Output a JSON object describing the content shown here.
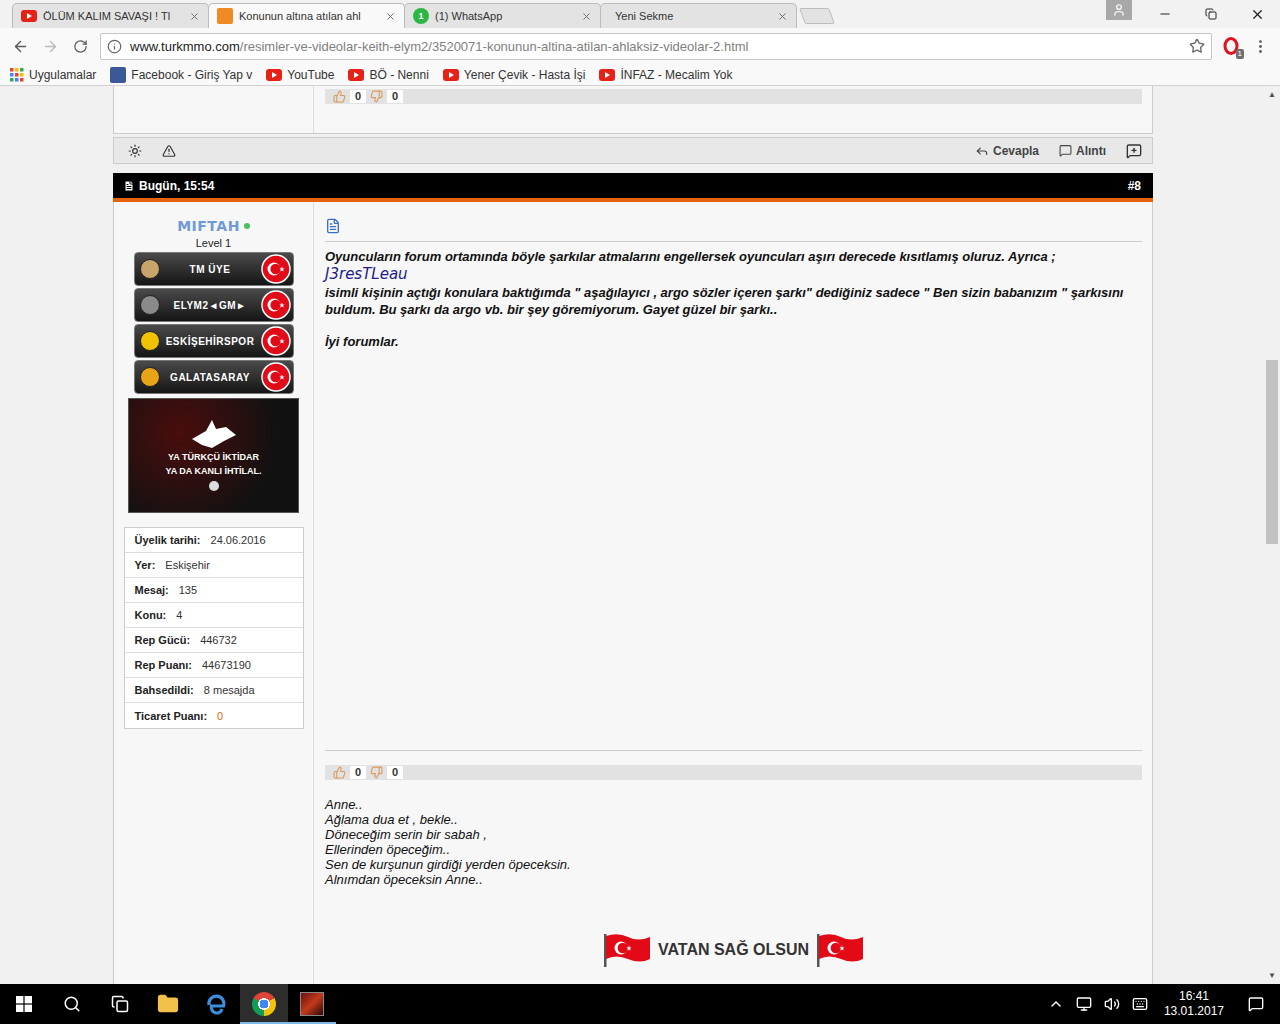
{
  "tabs": [
    {
      "label": "ÖLÜM KALIM SAVAŞI ! Tl",
      "kind": "youtube",
      "selected": false
    },
    {
      "label": "Konunun altına atılan ahl",
      "kind": "site",
      "selected": true
    },
    {
      "label": "(1) WhatsApp",
      "kind": "whatsapp",
      "badge": "1",
      "selected": false
    },
    {
      "label": "Yeni Sekme",
      "kind": "blank",
      "selected": false
    }
  ],
  "address_bar": {
    "host": "www.turkmmo.com",
    "path": "/resimler-ve-videolar-keith-elym2/3520071-konunun-altina-atilan-ahlaksiz-videolar-2.html",
    "starred": false
  },
  "extension": {
    "badge": "1"
  },
  "bookmarks": [
    {
      "label": "Uygulamalar",
      "kind": "apps"
    },
    {
      "label": "Facebook - Giriş Yap v",
      "kind": "facebook"
    },
    {
      "label": "YouTube",
      "kind": "youtube"
    },
    {
      "label": "BÖ - Nenni",
      "kind": "youtube"
    },
    {
      "label": "Yener Çevik - Hasta İşi",
      "kind": "youtube"
    },
    {
      "label": "İNFAZ - Mecalim Yok",
      "kind": "youtube"
    }
  ],
  "previous_post": {
    "likes": "0",
    "dislikes": "0"
  },
  "post_actions": [
    {
      "label": "Cevapla",
      "kind": "reply"
    },
    {
      "label": "Alıntı",
      "kind": "quote"
    }
  ],
  "post": {
    "date": "Bugün, 15:54",
    "number": "#8",
    "author": {
      "name": "MIFTAH",
      "online": true,
      "level": "Level 1",
      "badges": [
        {
          "label": "TM ÜYE",
          "color": "#c9a46a"
        },
        {
          "label": "ELYM2◄GM►",
          "color": "#8a8a8a"
        },
        {
          "label": "ESKİŞEHİRSPOR",
          "color": "#f2c200"
        },
        {
          "label": "GALATASARAY",
          "color": "#e8a317"
        }
      ],
      "avatar_lines": [
        "YA TÜRKÇÜ İKTİDAR",
        "YA DA KANLI İHTİLAL."
      ],
      "info": [
        {
          "label": "Üyelik tarihi:",
          "value": "24.06.2016",
          "color": "#333333"
        },
        {
          "label": "Yer:",
          "value": "Eskişehir",
          "color": "#333333"
        },
        {
          "label": "Mesaj:",
          "value": "135",
          "color": "#333333"
        },
        {
          "label": "Konu:",
          "value": "4",
          "color": "#333333"
        },
        {
          "label": "Rep Gücü:",
          "value": "446732",
          "color": "#333333"
        },
        {
          "label": "Rep Puanı:",
          "value": "44673190",
          "color": "#333333"
        },
        {
          "label": "Bahsedildi:",
          "value": "8 mesajda",
          "color": "#333333"
        },
        {
          "label": "Ticaret Puanı:",
          "value": "0",
          "color": "#e8620e"
        }
      ]
    },
    "message": [
      {
        "kind": "text",
        "text": "Oyuncuların forum ortamında böyle şarkılar atmalarını engellersek oyuncuları aşırı derecede kısıtlamış oluruz. Ayrıca ;"
      },
      {
        "kind": "mention",
        "text": "J3resTLeau"
      },
      {
        "kind": "text",
        "text": "isimli kişinin açtığı konulara baktığımda \" aşağılayıcı , argo sözler içeren şarkı\" dediğiniz sadece \" Ben sizin babanızım \" şarkısını buldum. Bu şarkı da argo vb. bir şey göremiyorum. Gayet güzel bir şarkı.."
      },
      {
        "kind": "closing",
        "text": "İyi forumlar."
      }
    ],
    "likes": "0",
    "dislikes": "0",
    "signature": [
      "Anne..",
      "Ağlama dua et , bekle..",
      "Döneceğim serin bir sabah ,",
      "Ellerinden öpeceğim..",
      "Sen de kurşunun girdiği yerden öpeceksin.",
      "Alnımdan öpeceksin Anne.."
    ],
    "motto": "VATAN SAĞ OLSUN"
  },
  "scrollbar": {
    "thumb_start": 0.297,
    "level": 0.214
  },
  "taskbar": {
    "apps": [
      {
        "kind": "explorer",
        "running": false,
        "selected": false
      },
      {
        "kind": "edge",
        "running": false,
        "selected": false
      },
      {
        "kind": "chrome",
        "running": true,
        "selected": true
      },
      {
        "kind": "game",
        "running": true,
        "selected": false
      }
    ],
    "clock": {
      "time": "16:41",
      "date": "13.01.2017"
    }
  }
}
